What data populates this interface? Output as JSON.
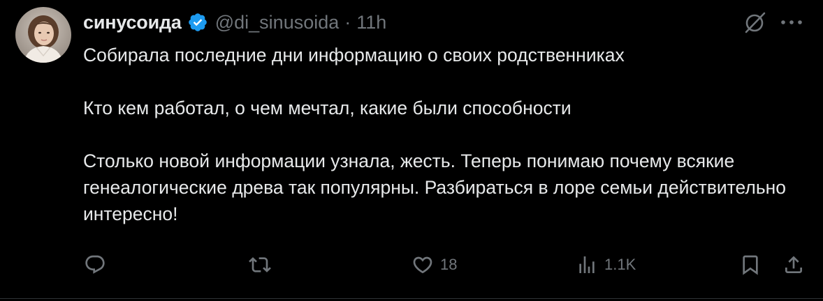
{
  "tweet": {
    "author": {
      "display_name": "синусоида",
      "handle": "@di_sinusoida",
      "verified": true,
      "avatar_icon": "profile-photo"
    },
    "separator": "·",
    "time": "11h",
    "paragraphs": [
      "Собирала последние дни информацию о своих родственниках",
      "Кто кем работал, о чем мечтал, какие были способности",
      "Столько новой информации узнала, жесть. Теперь понимаю почему всякие генеалогические древа так популярны. Разбираться в лоре семьи действительно интересно!"
    ],
    "actions": {
      "reply": {
        "icon": "reply-icon",
        "count": ""
      },
      "repost": {
        "icon": "repost-icon",
        "count": ""
      },
      "like": {
        "icon": "heart-icon",
        "count": "18"
      },
      "views": {
        "icon": "views-icon",
        "count": "1.1K"
      },
      "bookmark": {
        "icon": "bookmark-icon"
      },
      "share": {
        "icon": "share-icon"
      }
    },
    "header_icons": [
      "grok-icon",
      "more-icon"
    ]
  },
  "colors": {
    "background": "#000000",
    "text": "#e7e9ea",
    "secondary": "#71767b",
    "verified": "#1d9bf0",
    "divider": "#2f3336"
  }
}
